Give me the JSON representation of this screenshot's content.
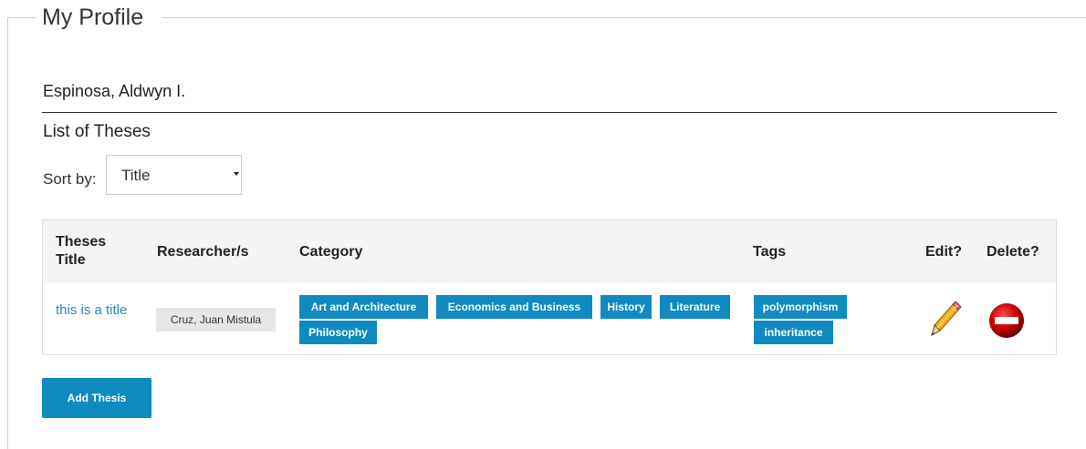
{
  "page": {
    "legend": "My Profile",
    "user_name": "Espinosa, Aldwyn I.",
    "section_title": "List of Theses"
  },
  "sort": {
    "label": "Sort by:",
    "selected": "Title"
  },
  "table": {
    "headers": {
      "title": "Theses Title",
      "researcher": "Researcher/s",
      "category": "Category",
      "tags": "Tags",
      "edit": "Edit?",
      "delete": "Delete?"
    },
    "rows": [
      {
        "title": "this is a title",
        "researcher": "Cruz, Juan Mistula",
        "categories": [
          "Art and Architecture",
          "Economics and Business",
          "History",
          "Literature",
          "Philosophy"
        ],
        "tags": [
          "polymorphism",
          "inheritance"
        ],
        "edit_icon": "pencil-icon",
        "delete_icon": "no-entry-icon"
      }
    ]
  },
  "actions": {
    "add_label": "Add Thesis"
  },
  "colors": {
    "accent": "#0f8bbf",
    "link": "#2a86b6",
    "delete_red": "#c00000"
  }
}
